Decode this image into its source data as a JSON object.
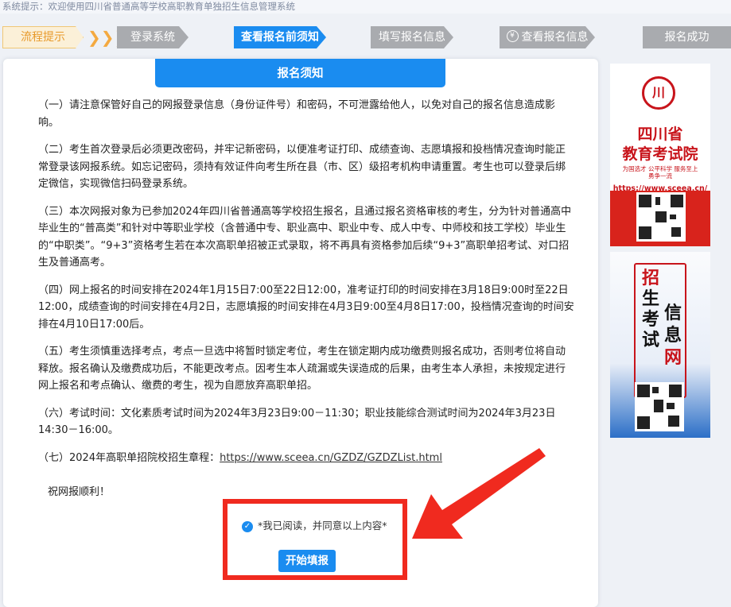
{
  "system_tip": "系统提示：欢迎使用四川省普通高等学校高职教育单独招生信息管理系统",
  "steps": {
    "tip": "流程提示",
    "chevrons": "❯❯❯",
    "login": "登录系统",
    "notice": "查看报名前须知",
    "fill": "填写报名信息",
    "view": "查看报名信息",
    "success": "报名成功",
    "yen_icon": "¥"
  },
  "card": {
    "title": "报名须知",
    "paragraphs": [
      "（一）请注意保管好自己的网报登录信息（身份证件号）和密码，不可泄露给他人，以免对自己的报名信息造成影响。",
      "（二）考生首次登录后必须更改密码，并牢记新密码，以便准考证打印、成绩查询、志愿填报和投档情况查询时能正常登录该网报系统。如忘记密码，须持有效证件向考生所在县（市、区）级招考机构申请重置。考生也可以登录后绑定微信，实现微信扫码登录系统。",
      "（三）本次网报对象为已参加2024年四川省普通高等学校招生报名，且通过报名资格审核的考生，分为针对普通高中毕业生的“普高类”和针对中等职业学校（含普通中专、职业高中、职业中专、成人中专、中师校和技工学校）毕业生的“中职类”。“9+3”资格考生若在本次高职单招被正式录取，将不再具有资格参加后续“9+3”高职单招考试、对口招生及普通高考。",
      "（四）网上报名的时间安排在2024年1月15日7:00至22日12:00，准考证打印的时间安排在3月18日9:00时至22日12:00，成绩查询的时间安排在4月2日，志愿填报的时间安排在4月3日9:00至4月8日17:00，投档情况查询的时间安排在4月10日17:00后。",
      "（五）考生须慎重选择考点，考点一旦选中将暂时锁定考位，考生在锁定期内成功缴费则报名成功，否则考位将自动释放。报名确认及缴费成功后，不能更改考点。因考生本人疏漏或失误造成的后果，由考生本人承担，未按规定进行网上报名和考点确认、缴费的考生，视为自愿放弃高职单招。",
      "（六）考试时间：文化素质考试时间为2024年3月23日9:00－11:30；职业技能综合测试时间为2024年3月23日14:30－16:00。"
    ],
    "p7_prefix": "（七）2024年高职单招院校招生章程：",
    "p7_link": "https://www.sceea.cn/GZDZ/GZDZList.html",
    "wish": "祝网报顺利！",
    "agree_label": "*我已阅读，并同意以上内容*",
    "check_icon": "✓",
    "start_button": "开始填报"
  },
  "banner1": {
    "emblem": "川",
    "line1": "四川省",
    "line2": "教育考试院",
    "motto1": "为国选才  公平科学  服务至上",
    "motto2": "勇争一流",
    "url": "https://www.sceea.cn/"
  },
  "banner2": {
    "chars_left": [
      "招",
      "生",
      "考",
      "试"
    ],
    "chars_right": [
      "信",
      "息",
      "网"
    ]
  },
  "colors": {
    "accent_blue": "#1a8cf0",
    "step_gray": "#a9abaf",
    "highlight_red": "#f02a1f"
  }
}
